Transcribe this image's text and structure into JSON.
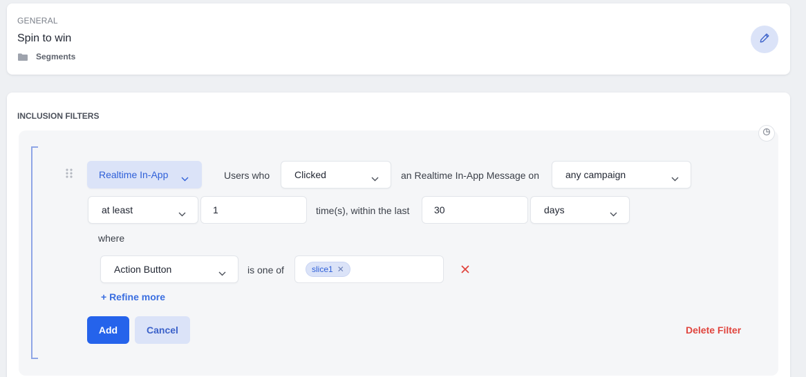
{
  "general": {
    "section_label": "GENERAL",
    "title": "Spin to win",
    "folder_label": "Segments"
  },
  "filters": {
    "section_label": "INCLUSION FILTERS",
    "channel": "Realtime In-App",
    "users_who_label": "Users who",
    "action": "Clicked",
    "message_label": "an Realtime In-App Message on",
    "campaign": "any campaign",
    "frequency": "at least",
    "count_value": "1",
    "times_label": "time(s), within the last",
    "period_value": "30",
    "period_unit": "days",
    "where_label": "where",
    "property": "Action Button",
    "operator_label": "is one of",
    "values": [
      "slice1"
    ],
    "refine_label": "+ Refine more",
    "add_label": "Add",
    "cancel_label": "Cancel",
    "delete_label": "Delete Filter"
  },
  "colors": {
    "accent": "#2563eb",
    "accent_soft": "#dbe3f8",
    "danger": "#e0443d"
  }
}
